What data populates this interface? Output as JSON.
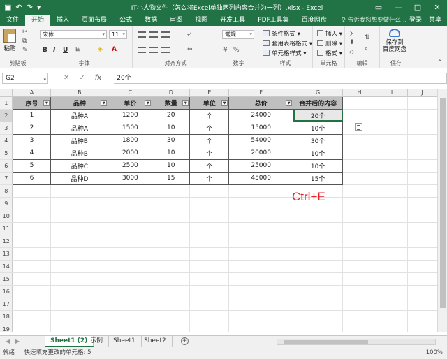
{
  "title_bar": {
    "title": "IT小人物文件（怎么将Excel单独两列内容合并为一列）.xlsx - Excel"
  },
  "menu": {
    "file": "文件",
    "tabs": [
      "开始",
      "插入",
      "页面布局",
      "公式",
      "数据",
      "审阅",
      "视图",
      "开发工具",
      "PDF工具集",
      "百度网盘"
    ],
    "active_tab": "开始",
    "tell_me": "♀ 告诉我您想要做什么...",
    "login": "登录",
    "share": "共享"
  },
  "ribbon": {
    "paste": "粘贴",
    "clipboard": "剪贴板",
    "font_name": "宋体",
    "font_size": "11",
    "font_group": "字体",
    "align_group": "对齐方式",
    "number_format": "常规",
    "number_group": "数字",
    "cond_format": "条件格式 ▾",
    "table_format": "套用表格格式 ▾",
    "cell_style": "单元格样式 ▾",
    "style_group": "样式",
    "insert": "插入 ▾",
    "delete": "删除 ▾",
    "format": "格式 ▾",
    "cells_group": "单元格",
    "edit_group": "编辑",
    "save_baidu": "保存到\n百度网盘",
    "save_group": "保存"
  },
  "formula_bar": {
    "name_box": "G2",
    "fx": "fx",
    "value": "20个"
  },
  "grid": {
    "columns": [
      "A",
      "B",
      "C",
      "D",
      "E",
      "F",
      "G",
      "H",
      "I",
      "J"
    ],
    "rows": [
      "1",
      "2",
      "3",
      "4",
      "5",
      "6",
      "7",
      "8",
      "9",
      "10",
      "11",
      "12",
      "13",
      "14",
      "15",
      "16",
      "17",
      "18",
      "19"
    ],
    "headers": [
      "序号",
      "品种",
      "单价",
      "数量",
      "单位",
      "总价",
      "合并后的内容"
    ],
    "data": [
      [
        "1",
        "品种A",
        "1200",
        "20",
        "个",
        "24000",
        "20个"
      ],
      [
        "2",
        "品种A",
        "1500",
        "10",
        "个",
        "15000",
        "10个"
      ],
      [
        "3",
        "品种B",
        "1800",
        "30",
        "个",
        "54000",
        "30个"
      ],
      [
        "4",
        "品种B",
        "2000",
        "10",
        "个",
        "20000",
        "10个"
      ],
      [
        "5",
        "品种C",
        "2500",
        "10",
        "个",
        "25000",
        "10个"
      ],
      [
        "6",
        "品种D",
        "3000",
        "15",
        "个",
        "45000",
        "15个"
      ]
    ],
    "annotation": "Ctrl+E"
  },
  "sheet_tabs": [
    "Sheet1 (2)",
    "示例",
    "Sheet1",
    "Sheet2"
  ],
  "active_sheet": "Sheet1 (2)",
  "status_bar": {
    "ready": "就绪",
    "message": "快速填充更改的单元格: 5",
    "zoom": "100%"
  },
  "colors": {
    "excel_green": "#217346",
    "annotation_red": "#e8202a",
    "header_fill": "#bfbfbf"
  }
}
